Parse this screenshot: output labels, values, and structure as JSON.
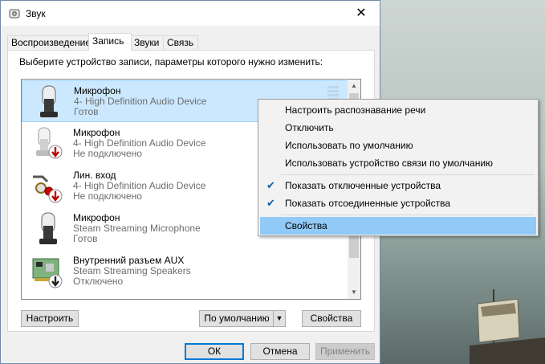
{
  "window": {
    "title": "Звук",
    "close_glyph": "✕"
  },
  "tabs": [
    {
      "label": "Воспроизведение"
    },
    {
      "label": "Запись"
    },
    {
      "label": "Звуки"
    },
    {
      "label": "Связь"
    }
  ],
  "active_tab": "Запись",
  "instruction": "Выберите устройство записи, параметры которого нужно изменить:",
  "devices": [
    {
      "name": "Микрофон",
      "desc": "4- High Definition Audio Device",
      "status": "Готов",
      "icon": "microphone-icon",
      "selected": true
    },
    {
      "name": "Микрофон",
      "desc": "4- High Definition Audio Device",
      "status": "Не подключено",
      "icon": "microphone-icon",
      "badge": "disconnected-badge-icon"
    },
    {
      "name": "Лин. вход",
      "desc": "4- High Definition Audio Device",
      "status": "Не подключено",
      "icon": "line-in-jack-icon",
      "badge": "disconnected-badge-icon"
    },
    {
      "name": "Микрофон",
      "desc": "Steam Streaming Microphone",
      "status": "Готов",
      "icon": "microphone-icon"
    },
    {
      "name": "Внутренний разъем  AUX",
      "desc": "Steam Streaming Speakers",
      "status": "Отключено",
      "icon": "sound-card-icon",
      "badge": "disabled-badge-icon"
    }
  ],
  "buttons": {
    "configure": "Настроить",
    "default": "По умолчанию",
    "properties": "Свойства",
    "ok": "ОК",
    "cancel": "Отмена",
    "apply": "Применить"
  },
  "context_menu": {
    "items": [
      {
        "label": "Настроить распознавание речи"
      },
      {
        "label": "Отключить"
      },
      {
        "label": "Использовать по умолчанию"
      },
      {
        "label": "Использовать устройство связи по умолчанию"
      },
      {
        "label": "Показать отключенные устройства",
        "checked": true
      },
      {
        "label": "Показать отсоединенные устройства",
        "checked": true
      },
      {
        "label": "Свойства",
        "highlighted": true
      }
    ]
  },
  "colors": {
    "selection": "#cce8ff",
    "menu_highlight": "#91c9f7",
    "accent": "#0078d7"
  }
}
